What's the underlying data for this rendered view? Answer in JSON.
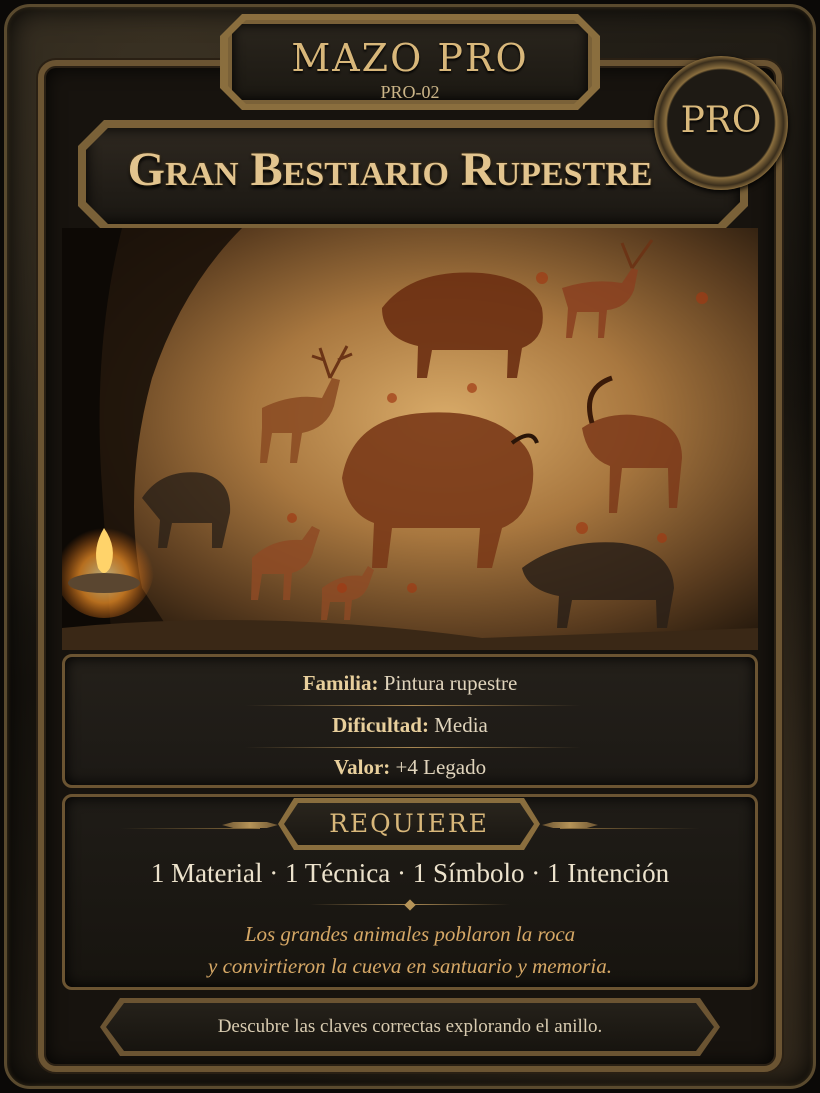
{
  "deck": {
    "title": "MAZO PRO",
    "code": "PRO-02"
  },
  "badge": {
    "label": "PRO"
  },
  "card": {
    "title": "Gran Bestiario Rupestre"
  },
  "art": {
    "subject": "cave-painting-animals-illustration"
  },
  "info": {
    "family_label": "Familia:",
    "family_value": "Pintura rupestre",
    "difficulty_label": "Dificultad:",
    "difficulty_value": "Media",
    "value_label": "Valor:",
    "value_value": "+4 Legado"
  },
  "requirements": {
    "label": "REQUIERE",
    "items_text": "1 Material · 1 Técnica · 1 Símbolo · 1 Intención",
    "flavor_line1": "Los grandes animales poblaron la roca",
    "flavor_line2": "y convirtieron la cueva en santuario y memoria."
  },
  "footer": {
    "hint": "Descubre las claves correctas explorando el anillo."
  },
  "colors": {
    "gold": "#d8b77a",
    "frame": "#6b5432",
    "flavor": "#d6a866"
  }
}
